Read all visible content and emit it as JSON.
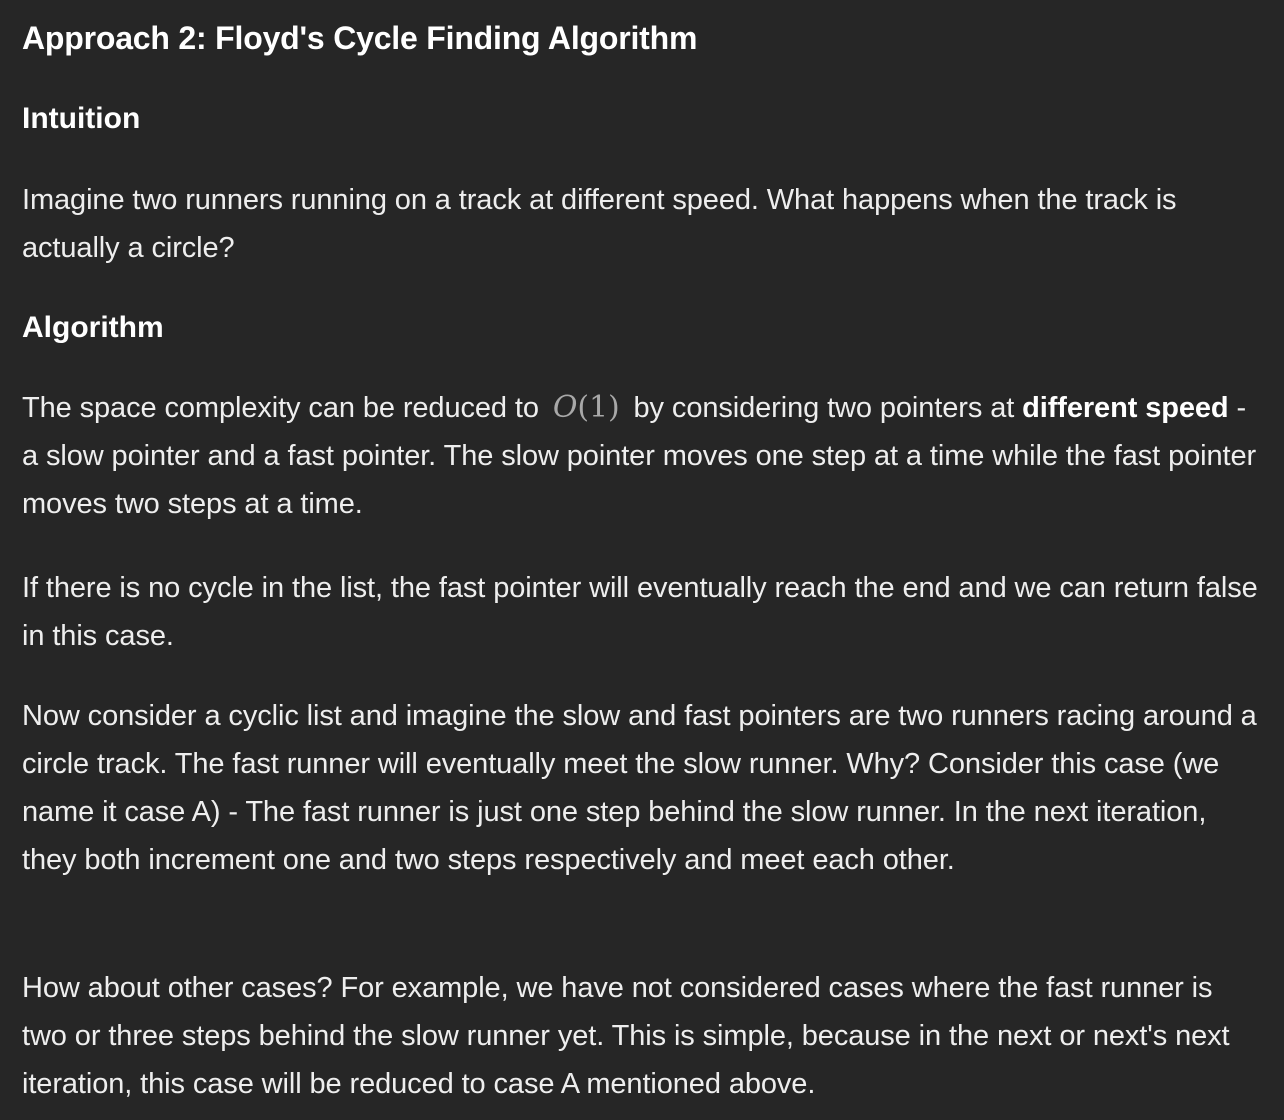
{
  "title": "Approach 2: Floyd's Cycle Finding Algorithm",
  "intuition": {
    "heading": "Intuition",
    "text": "Imagine two runners running on a track at different speed. What happens when the track is actually a circle?"
  },
  "algorithm": {
    "heading": "Algorithm",
    "p1_before": "The space complexity can be reduced to",
    "p1_math_letter": "O",
    "p1_math_rest": "(1)",
    "p1_after": "by considering two pointers at",
    "p1_bold": "different speed",
    "p1_tail": "- a slow pointer and a fast pointer. The slow pointer moves one step at a time while the fast pointer moves two steps at a time.",
    "p2": "If there is no cycle in the list, the fast pointer will eventually reach the end and we can return false in this case.",
    "p3": "Now consider a cyclic list and imagine the slow and fast pointers are two runners racing around a circle track. The fast runner will eventually meet the slow runner. Why? Consider this case (we name it case A) - The fast runner is just one step behind the slow runner. In the next iteration, they both increment one and two steps respectively and meet each other.",
    "p4": "How about other cases? For example, we have not considered cases where the fast runner is two or three steps behind the slow runner yet. This is simple, because in the next or next's next iteration, this case will be reduced to case A mentioned above."
  }
}
